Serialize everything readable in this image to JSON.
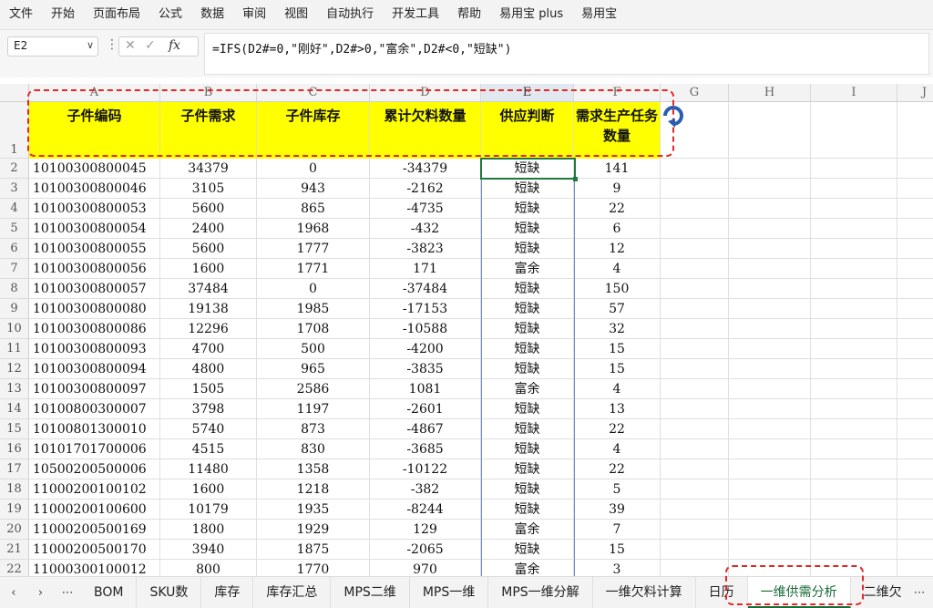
{
  "menu": [
    "文件",
    "开始",
    "页面布局",
    "公式",
    "数据",
    "审阅",
    "视图",
    "自动执行",
    "开发工具",
    "帮助",
    "易用宝 plus",
    "易用宝"
  ],
  "formula_bar": {
    "cell_ref": "E2",
    "dropdown_glyph": "∨",
    "more_glyph": "⋮",
    "cancel_glyph": "✕",
    "confirm_glyph": "✓",
    "fx_glyph": "fx",
    "formula": "=IFS(D2#=0,\"刚好\",D2#>0,\"富余\",D2#<0,\"短缺\")"
  },
  "columns": [
    "A",
    "B",
    "C",
    "D",
    "E",
    "F",
    "G",
    "H",
    "I",
    "J"
  ],
  "header_row": {
    "row_label": "1",
    "cells": [
      "子件编码",
      "子件需求",
      "子件库存",
      "累计欠料数量",
      "供应判断",
      "需求生产任务数量"
    ]
  },
  "rows": [
    {
      "n": "2",
      "cells": [
        "10100300800045",
        "34379",
        "0",
        "-34379",
        "短缺",
        "141"
      ]
    },
    {
      "n": "3",
      "cells": [
        "10100300800046",
        "3105",
        "943",
        "-2162",
        "短缺",
        "9"
      ]
    },
    {
      "n": "4",
      "cells": [
        "10100300800053",
        "5600",
        "865",
        "-4735",
        "短缺",
        "22"
      ]
    },
    {
      "n": "5",
      "cells": [
        "10100300800054",
        "2400",
        "1968",
        "-432",
        "短缺",
        "6"
      ]
    },
    {
      "n": "6",
      "cells": [
        "10100300800055",
        "5600",
        "1777",
        "-3823",
        "短缺",
        "12"
      ]
    },
    {
      "n": "7",
      "cells": [
        "10100300800056",
        "1600",
        "1771",
        "171",
        "富余",
        "4"
      ]
    },
    {
      "n": "8",
      "cells": [
        "10100300800057",
        "37484",
        "0",
        "-37484",
        "短缺",
        "150"
      ]
    },
    {
      "n": "9",
      "cells": [
        "10100300800080",
        "19138",
        "1985",
        "-17153",
        "短缺",
        "57"
      ]
    },
    {
      "n": "10",
      "cells": [
        "10100300800086",
        "12296",
        "1708",
        "-10588",
        "短缺",
        "32"
      ]
    },
    {
      "n": "11",
      "cells": [
        "10100300800093",
        "4700",
        "500",
        "-4200",
        "短缺",
        "15"
      ]
    },
    {
      "n": "12",
      "cells": [
        "10100300800094",
        "4800",
        "965",
        "-3835",
        "短缺",
        "15"
      ]
    },
    {
      "n": "13",
      "cells": [
        "10100300800097",
        "1505",
        "2586",
        "1081",
        "富余",
        "4"
      ]
    },
    {
      "n": "14",
      "cells": [
        "10100800300007",
        "3798",
        "1197",
        "-2601",
        "短缺",
        "13"
      ]
    },
    {
      "n": "15",
      "cells": [
        "10100801300010",
        "5740",
        "873",
        "-4867",
        "短缺",
        "22"
      ]
    },
    {
      "n": "16",
      "cells": [
        "10101701700006",
        "4515",
        "830",
        "-3685",
        "短缺",
        "4"
      ]
    },
    {
      "n": "17",
      "cells": [
        "10500200500006",
        "11480",
        "1358",
        "-10122",
        "短缺",
        "22"
      ]
    },
    {
      "n": "18",
      "cells": [
        "11000200100102",
        "1600",
        "1218",
        "-382",
        "短缺",
        "5"
      ]
    },
    {
      "n": "19",
      "cells": [
        "11000200100600",
        "10179",
        "1935",
        "-8244",
        "短缺",
        "39"
      ]
    },
    {
      "n": "20",
      "cells": [
        "11000200500169",
        "1800",
        "1929",
        "129",
        "富余",
        "7"
      ]
    },
    {
      "n": "21",
      "cells": [
        "11000200500170",
        "3940",
        "1875",
        "-2065",
        "短缺",
        "15"
      ]
    },
    {
      "n": "22",
      "cells": [
        "11000300100012",
        "800",
        "1770",
        "970",
        "富余",
        "3"
      ]
    }
  ],
  "sheet_tabs": {
    "nav_prev": "‹",
    "nav_next": "›",
    "nav_more": "⋯",
    "tabs": [
      "BOM",
      "SKU数",
      "库存",
      "库存汇总",
      "MPS二维",
      "MPS一维",
      "MPS一维分解",
      "一维欠料计算",
      "日历",
      "一维供需分析",
      "二维欠"
    ],
    "active": "一维供需分析",
    "overflow": "⋯"
  },
  "colors": {
    "header_fill": "#ffff00",
    "selection": "#1f7a3d",
    "annotation": "#e32626",
    "active_tab": "#1a6b3a"
  }
}
